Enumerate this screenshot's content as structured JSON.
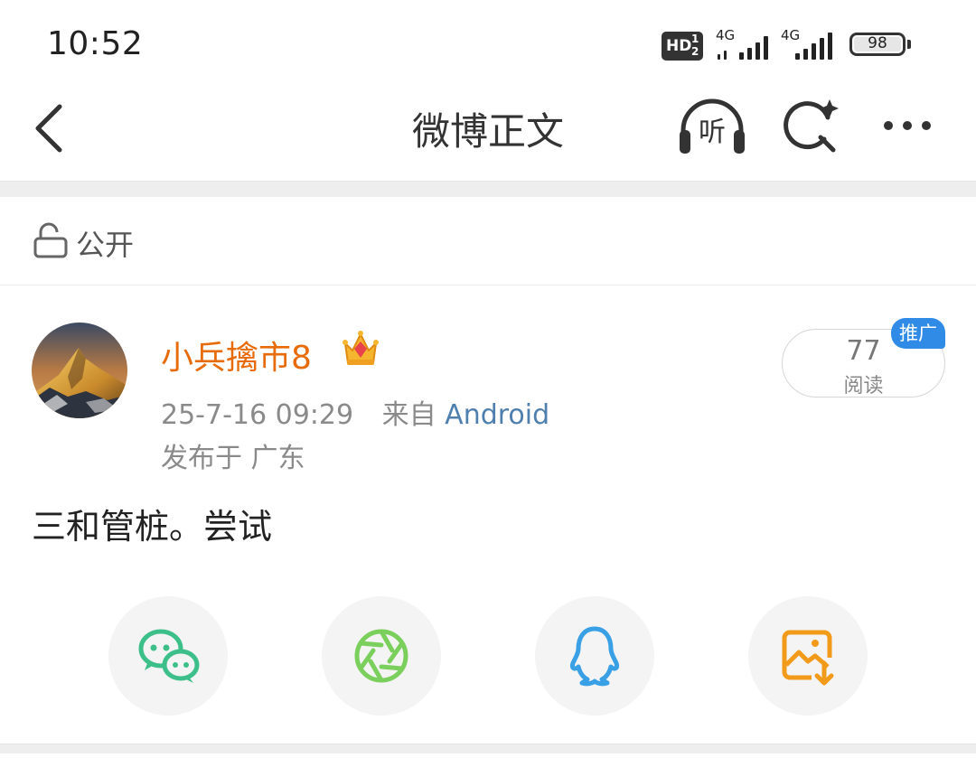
{
  "status_bar": {
    "time": "10:52",
    "hd_label": "HD",
    "hd_sup_1": "1",
    "hd_sup_2": "2",
    "signal_1_label": "4G",
    "signal_2_label": "4G",
    "battery_level": "98"
  },
  "nav": {
    "title": "微博正文",
    "listen_label": "听",
    "icons": [
      "back-arrow-icon",
      "listen-headphones-icon",
      "ai-search-icon",
      "more-dots-icon"
    ]
  },
  "post": {
    "visibility": "公开",
    "author": "小兵擒市8",
    "time": "25-7-16 09:29",
    "source_prefix": "来自",
    "source": "Android",
    "location": "发布于 广东",
    "read_count": "77",
    "read_label": "阅读",
    "promo_label": "推广",
    "text": "三和管桩。尝试"
  },
  "share": [
    {
      "icon": "wechat-icon",
      "color": "#3dbf8a"
    },
    {
      "icon": "moments-icon",
      "color": "#7bcf5c"
    },
    {
      "icon": "qq-icon",
      "color": "#3aa0e6"
    },
    {
      "icon": "save-image-icon",
      "color": "#f29a1a"
    }
  ],
  "colors": {
    "username": "#e86b0a",
    "source_link": "#4f7fae",
    "promo_badge": "#2f8be6"
  }
}
